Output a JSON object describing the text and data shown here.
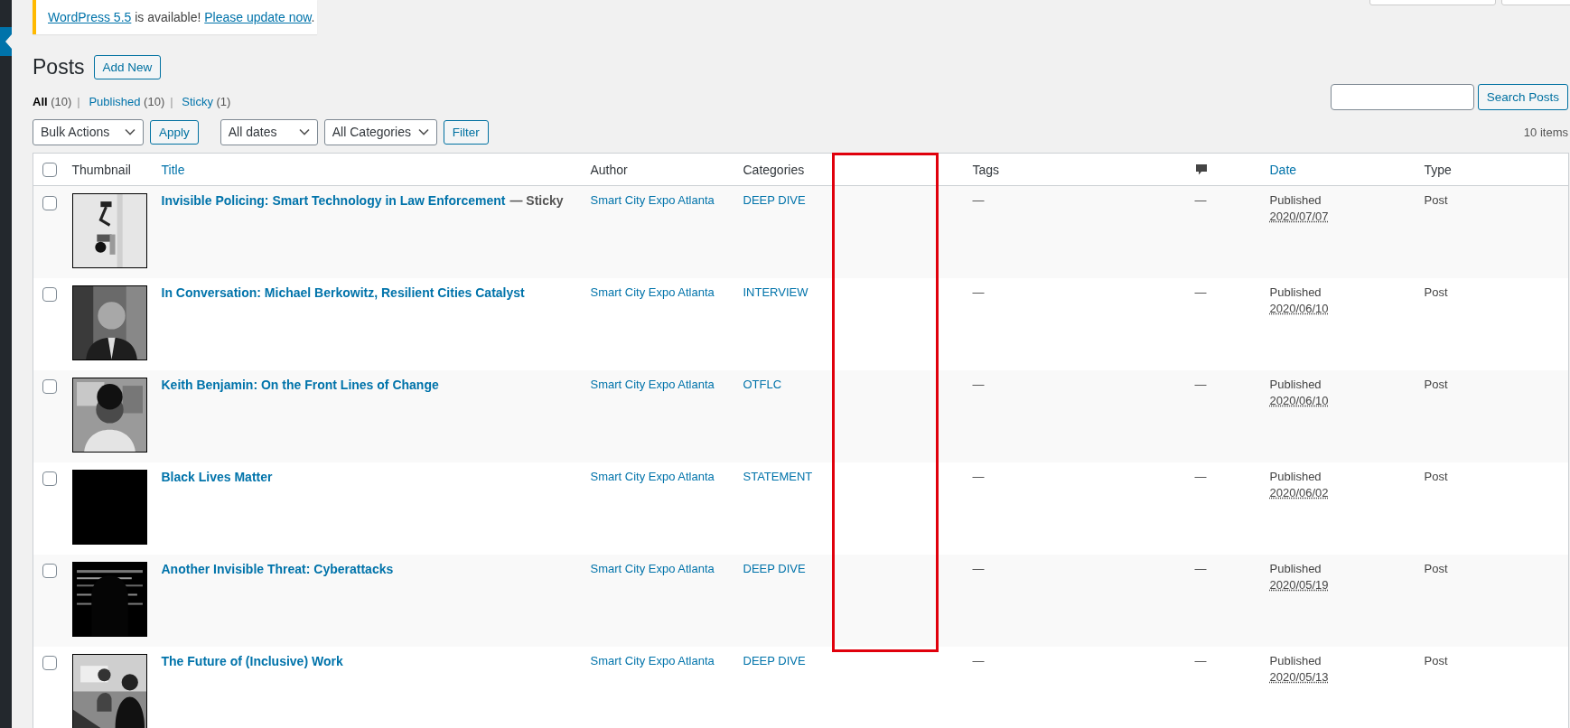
{
  "notice": {
    "link": "WordPress 5.5",
    "text": " is available! ",
    "action": "Please update now",
    "end": "."
  },
  "page_title": "Posts",
  "add_new": "Add New",
  "views": [
    {
      "label": "All",
      "count": "(10)",
      "selected": true
    },
    {
      "separator": "|",
      "label": "Published",
      "count": "(10)",
      "selected": false
    },
    {
      "separator": "|",
      "label": "Sticky",
      "count": "(1)",
      "selected": false
    }
  ],
  "search": {
    "button": "Search Posts"
  },
  "bulk_actions": {
    "value": "Bulk Actions",
    "button": "Apply"
  },
  "filters": [
    {
      "value": "All dates"
    },
    {
      "value": "All Categories"
    }
  ],
  "filter_button": "Filter",
  "item_count": "10 items",
  "table": {
    "select_all_checked": false,
    "columns": [
      {
        "label": "Thumbnail",
        "sortable": false
      },
      {
        "label": "Title",
        "sortable": true
      },
      {
        "label": "Author",
        "sortable": false
      },
      {
        "label": "Categories",
        "sortable": false
      },
      {
        "label": "Tags",
        "sortable": false
      },
      {
        "label": "Date",
        "sortable": true
      },
      {
        "label": "Type",
        "sortable": false
      }
    ],
    "rows": [
      {
        "checked": false,
        "title": "Invisible Policing: Smart Technology in Law Enforcement",
        "post_state": "— Sticky",
        "author": "Smart City Expo Atlanta",
        "category": "DEEP DIVE",
        "tags": "—",
        "comments": "—",
        "status": "Published",
        "date": "2020/07/07",
        "type": "Post"
      },
      {
        "checked": false,
        "title": "In Conversation: Michael Berkowitz, Resilient Cities Catalyst",
        "author": "Smart City Expo Atlanta",
        "category": "INTERVIEW",
        "tags": "—",
        "comments": "—",
        "status": "Published",
        "date": "2020/06/10",
        "type": "Post"
      },
      {
        "checked": false,
        "title": "Keith Benjamin: On the Front Lines of Change",
        "author": "Smart City Expo Atlanta",
        "category": "OTFLC",
        "tags": "—",
        "comments": "—",
        "status": "Published",
        "date": "2020/06/10",
        "type": "Post"
      },
      {
        "checked": false,
        "title": "Black Lives Matter",
        "author": "Smart City Expo Atlanta",
        "category": "STATEMENT",
        "tags": "—",
        "comments": "—",
        "status": "Published",
        "date": "2020/06/02",
        "type": "Post"
      },
      {
        "checked": false,
        "title": "Another Invisible Threat: Cyberattacks",
        "author": "Smart City Expo Atlanta",
        "category": "DEEP DIVE",
        "tags": "—",
        "comments": "—",
        "status": "Published",
        "date": "2020/05/19",
        "type": "Post"
      },
      {
        "checked": false,
        "title": "The Future of (Inclusive) Work",
        "author": "Smart City Expo Atlanta",
        "category": "DEEP DIVE",
        "tags": "—",
        "comments": "—",
        "status": "Published",
        "date": "2020/05/13",
        "type": "Post"
      }
    ]
  }
}
